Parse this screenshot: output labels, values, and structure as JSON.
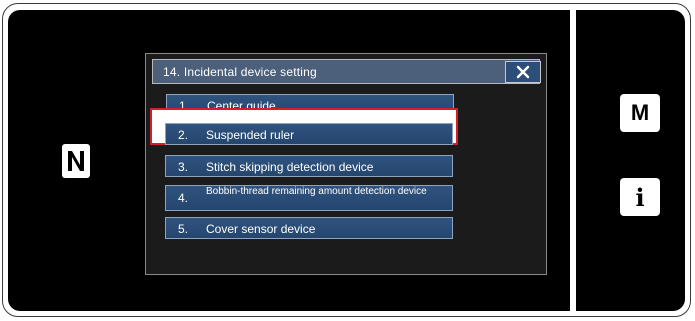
{
  "dialog": {
    "title": "14.  Incidental device setting",
    "close_icon": "close-icon"
  },
  "menu": {
    "items": [
      {
        "number": "1.",
        "label": "Center guide"
      },
      {
        "number": "2.",
        "label": "Suspended ruler"
      },
      {
        "number": "3.",
        "label": "Stitch skipping detection device"
      },
      {
        "number": "4.",
        "label": "Bobbin-thread remaining amount detection device"
      },
      {
        "number": "5.",
        "label": "Cover sensor device"
      }
    ],
    "selected_index": 1
  },
  "side_panel": {
    "mode_label": "M",
    "info_label": "i"
  },
  "icons": {
    "nfc": "nfc-icon",
    "close": "close-icon"
  },
  "colors": {
    "highlight": "#d0212b",
    "button_blue": "#2e4e7a",
    "title_bar": "#4c607c"
  }
}
